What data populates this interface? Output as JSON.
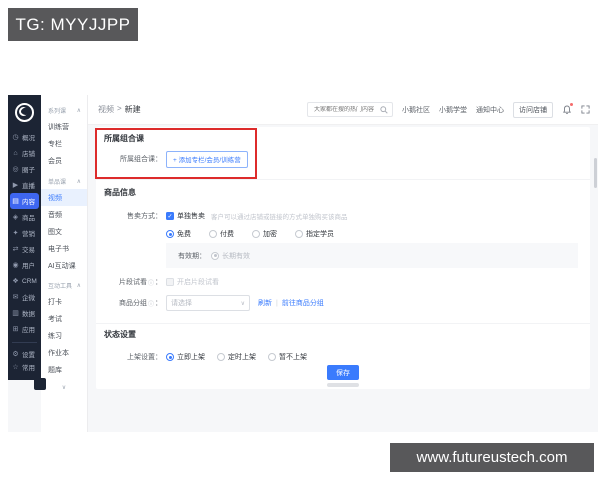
{
  "overlay": {
    "tg_badge": "TG: MYYJJPP",
    "site_badge": "www.futureustech.com"
  },
  "topbar": {
    "breadcrumb": {
      "parent": "视频",
      "separator": ">",
      "current": "新建"
    },
    "search_placeholder": "大家都在搜的热门内容",
    "links": [
      "小鹅社区",
      "小鹅学堂",
      "通知中心"
    ],
    "visit_shop": "访问店铺"
  },
  "primary_sidebar": {
    "items": [
      {
        "label": "概况",
        "glyph": "◷"
      },
      {
        "label": "店铺",
        "glyph": "⌂"
      },
      {
        "label": "圈子",
        "glyph": "◎"
      },
      {
        "label": "直播",
        "glyph": "▶"
      },
      {
        "label": "内容",
        "glyph": "▤"
      },
      {
        "label": "商品",
        "glyph": "◈"
      },
      {
        "label": "营销",
        "glyph": "✦"
      },
      {
        "label": "交易",
        "glyph": "⇄"
      },
      {
        "label": "用户",
        "glyph": "◉"
      },
      {
        "label": "CRM",
        "glyph": "❖"
      },
      {
        "label": "企微",
        "glyph": "✉"
      },
      {
        "label": "数据",
        "glyph": "▥"
      },
      {
        "label": "应用",
        "glyph": "⊞"
      }
    ],
    "footer": [
      {
        "label": "设置",
        "glyph": "⚙"
      },
      {
        "label": "常用",
        "glyph": "☆"
      }
    ]
  },
  "secondary_sidebar": {
    "groups": [
      {
        "header": "系列课",
        "items": [
          {
            "label": "训练营"
          },
          {
            "label": "专栏"
          },
          {
            "label": "会员"
          }
        ]
      },
      {
        "header": "单品课",
        "items": [
          {
            "label": "视频"
          },
          {
            "label": "音频"
          },
          {
            "label": "图文"
          },
          {
            "label": "电子书"
          },
          {
            "label": "AI互动课"
          }
        ]
      },
      {
        "header": "互动工具",
        "items": [
          {
            "label": "打卡"
          },
          {
            "label": "考试"
          },
          {
            "label": "练习"
          },
          {
            "label": "作业本"
          },
          {
            "label": "题库"
          }
        ]
      }
    ]
  },
  "content": {
    "combo": {
      "title": "所属组合课",
      "label": "所属组合课：",
      "add_button": "+ 添加专栏/会员/训练营"
    },
    "product": {
      "title": "商品信息",
      "sell_label": "售卖方式：",
      "sell_checkbox": "单独售卖",
      "sell_hint": "客户可以通过店铺或链接的方式单独购买该商品",
      "price_options": [
        "免费",
        "付费",
        "加密",
        "指定学员"
      ],
      "price_selected": "免费",
      "validity_label": "有效期：",
      "validity_value": "长期有效",
      "trial_label": "片段试看",
      "trial_text": "开启片段试看",
      "group_label": "商品分组",
      "group_placeholder": "请选择",
      "refresh_link": "刷新",
      "link_sep": "|",
      "goto_link": "前往商品分组",
      "colon": "："
    },
    "status": {
      "title": "状态设置",
      "shelf_label": "上架设置：",
      "shelf_options": [
        "立即上架",
        "定时上架",
        "暂不上架"
      ],
      "shelf_selected": "立即上架",
      "save_button": "保存"
    }
  },
  "icons": {
    "check": "✓",
    "info": "ⓘ",
    "collapse": "∧",
    "expand": "∨",
    "caret_down": "∨"
  },
  "colors": {
    "primary_blue": "#3a7bfd",
    "annotation_red": "#dd2b2b",
    "sidebar_dark": "#1c2434",
    "badge_gray": "#58585a"
  }
}
